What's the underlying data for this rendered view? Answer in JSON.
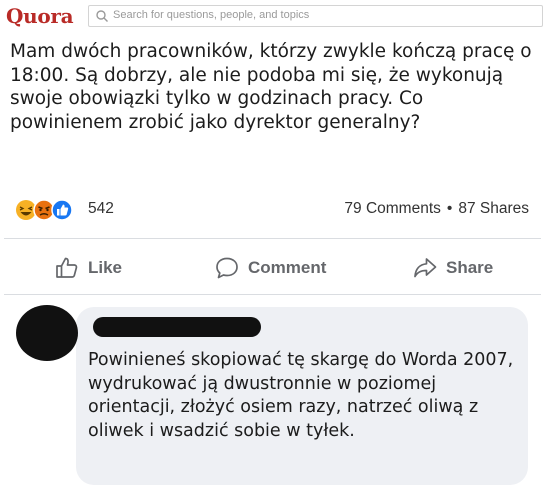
{
  "header": {
    "logo": "Quora",
    "search_placeholder": "Search for questions, people, and topics"
  },
  "question": {
    "text": "Mam dwóch pracowników, którzy zwykle kończą pracę o 18:00. Są dobrzy, ale nie podoba mi się, że wykonują swoje obowiązki tylko w godzinach pracy. Co powinienem zrobić jako dyrektor generalny?"
  },
  "engagement": {
    "reactions": [
      "laugh",
      "angry",
      "like"
    ],
    "reaction_count": "542",
    "comments": "79 Comments",
    "separator": "•",
    "shares": "87 Shares"
  },
  "actions": {
    "like": "Like",
    "comment": "Comment",
    "share": "Share"
  },
  "comment": {
    "text": "Powinieneś skopiować tę skargę do Worda 2007, wydrukować ją dwustronnie w poziomej orientacji, złożyć osiem razy, natrzeć oliwą z oliwek i wsadzić sobie w tyłek."
  },
  "colors": {
    "brand": "#b92b27",
    "like_blue": "#1877f2",
    "reaction_yellow": "#f7b125",
    "angry_red": "#e9710f",
    "bubble_bg": "#eef0f4"
  }
}
